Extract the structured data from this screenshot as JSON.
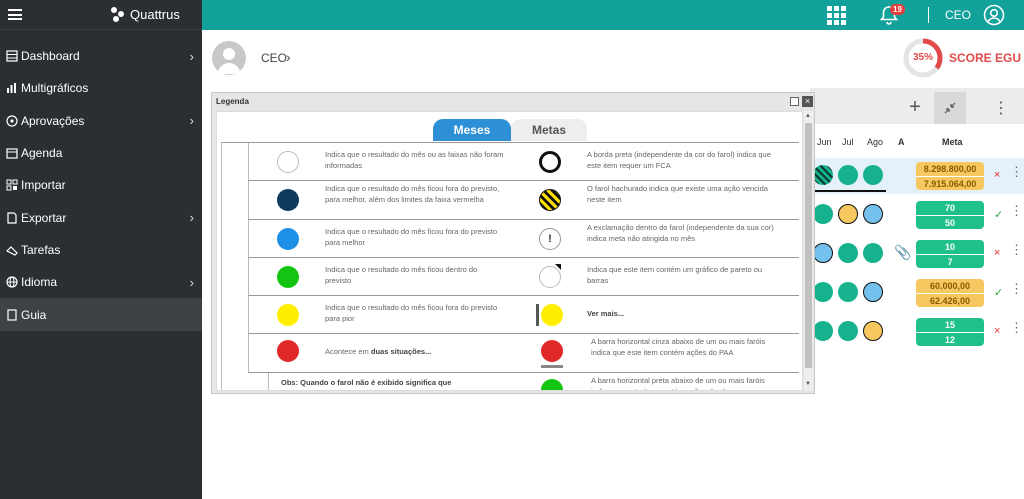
{
  "sidebar": {
    "logo_text": "Quattrus",
    "items": [
      {
        "label": "Dashboard",
        "icon": "dashboard-icon",
        "chevron": true
      },
      {
        "label": "Multigráficos",
        "icon": "chart-icon",
        "chevron": false
      },
      {
        "label": "Aprovações",
        "icon": "approval-icon",
        "chevron": true
      },
      {
        "label": "Agenda",
        "icon": "calendar-icon",
        "chevron": false
      },
      {
        "label": "Importar",
        "icon": "import-icon",
        "chevron": false
      },
      {
        "label": "Exportar",
        "icon": "export-icon",
        "chevron": true
      },
      {
        "label": "Tarefas",
        "icon": "tasks-icon",
        "chevron": false
      },
      {
        "label": "Idioma",
        "icon": "globe-icon",
        "chevron": true
      },
      {
        "label": "Guia",
        "icon": "guide-icon",
        "chevron": false,
        "active": true
      }
    ]
  },
  "topbar": {
    "notifications": "19",
    "user": "CEO",
    "color": "#13a19c"
  },
  "breadcrumb": {
    "label": "CEO"
  },
  "score": {
    "percent_text": "35%",
    "value": 0.35,
    "label": "SCORE EGU",
    "color": "#e24a4a"
  },
  "grid": {
    "columns": [
      "Jun",
      "Jul",
      "Ago",
      "A",
      "Meta"
    ],
    "rows": [
      {
        "meta": [
          "8.298.800,00",
          "7.915.064,00"
        ],
        "meta_color": "#f6c85f",
        "mark": "×"
      },
      {
        "meta": [
          "70",
          "50"
        ],
        "meta_color": "#20c08a",
        "mark": "✓"
      },
      {
        "meta": [
          "10",
          "7"
        ],
        "meta_color": "#20c08a",
        "mark": "×"
      },
      {
        "meta": [
          "60.000,00",
          "62.426,00"
        ],
        "meta_color": "#f6c85f",
        "mark": "✓"
      },
      {
        "meta": [
          "15",
          "12"
        ],
        "meta_color": "#20c08a",
        "mark": "×"
      }
    ]
  },
  "legend": {
    "title": "Legenda",
    "tabs": [
      "Meses",
      "Metas"
    ],
    "rows": [
      {
        "left_color": "#ffffff",
        "left_text": "Indica que o resultado do mês ou as faixas não foram informadas",
        "right_kind": "black-ring",
        "right_text": "A borda preta (independente da cor do farol) indica que este item requer um FCA"
      },
      {
        "left_color": "#0e3a5c",
        "left_text": "Indica que o resultado do mês ficou fora do previsto, para melhor, além dos limites da faixa vermelha",
        "right_kind": "hatched",
        "right_text": "O farol hachurado indica que existe uma ação vencida neste item"
      },
      {
        "left_color": "#1e8fe6",
        "left_text": "Indica que o resultado do mês ficou fora do previsto para melhor",
        "right_kind": "exclamation",
        "right_text": "A exclamação dentro do farol (independente da sua cor) indica meta não atingida no mês"
      },
      {
        "left_color": "#13c413",
        "left_text": "Indica que o resultado do mês ficou dentro do previsto",
        "right_kind": "corner",
        "right_text": "Indica que este item contém um gráfico de pareto ou barras"
      },
      {
        "left_color": "#ffee00",
        "left_text": "Indica que o resultado do mês ficou fora do previsto para pior",
        "right_kind": "bar-yellow",
        "right_text": "Ver mais..."
      },
      {
        "left_color": "#e02a2a",
        "left_text_pre": "Acontece em ",
        "left_text_bold": "duas situações...",
        "right_kind": "gray-bar",
        "right_text": "A barra horizontal cinza abaixo de um ou mais faróis indica que este item contém ações do PAA"
      }
    ],
    "last": {
      "left_text": "Obs: Quando o farol não é exibido significa que este mês não será medido",
      "right_text": "A barra horizontal preta abaixo de um ou mais faróis indica que este item contém ações do plano"
    }
  }
}
